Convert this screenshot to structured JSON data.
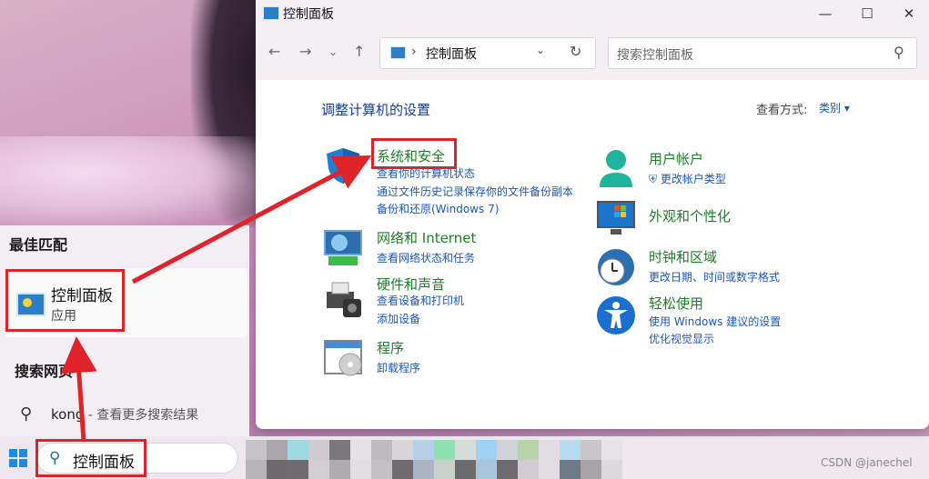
{
  "start_panel": {
    "best_match_title": "最佳匹配",
    "best_match_name": "控制面板",
    "best_match_type": "应用",
    "web_search_title": "搜索网页",
    "web_query": "kong",
    "web_suffix": " - 查看更多搜索结果"
  },
  "taskbar": {
    "search_value": "控制面板",
    "watermark": "CSDN @janechel"
  },
  "window": {
    "title": "控制面板",
    "address_crumb": "控制面板",
    "search_placeholder": "搜索控制面板",
    "heading": "调整计算机的设置",
    "view_label": "查看方式:",
    "view_value": "类别"
  },
  "categories_left": [
    {
      "title": "系统和安全",
      "links": [
        "查看你的计算机状态",
        "通过文件历史记录保存你的文件备份副本",
        "备份和还原(Windows 7)"
      ],
      "icon": "shield-icon"
    },
    {
      "title": "网络和 Internet",
      "links": [
        "查看网络状态和任务"
      ],
      "icon": "network-icon"
    },
    {
      "title": "硬件和声音",
      "links": [
        "查看设备和打印机",
        "添加设备"
      ],
      "icon": "printer-icon"
    },
    {
      "title": "程序",
      "links": [
        "卸载程序"
      ],
      "icon": "programs-icon"
    }
  ],
  "categories_right": [
    {
      "title": "用户帐户",
      "links": [
        "更改帐户类型"
      ],
      "icon": "user-icon"
    },
    {
      "title": "外观和个性化",
      "links": [],
      "icon": "appearance-icon"
    },
    {
      "title": "时钟和区域",
      "links": [
        "更改日期、时间或数字格式"
      ],
      "icon": "clock-icon"
    },
    {
      "title": "轻松使用",
      "links": [
        "使用 Windows 建议的设置",
        "优化视觉显示"
      ],
      "icon": "accessibility-icon"
    }
  ],
  "colors": {
    "accent_red": "#e0232b",
    "link_blue": "#1b57b8",
    "category_green": "#1f7d2a"
  }
}
